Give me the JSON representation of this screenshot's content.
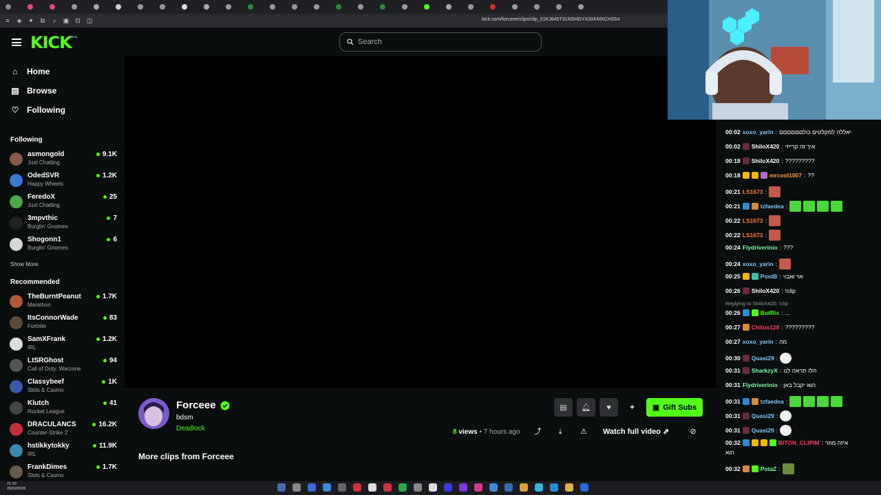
{
  "browser": {
    "url": "kick.com/forceee/clips/clip_01KJ845T31NSHGYX3XKMXCH3S4"
  },
  "header": {
    "logo": "KICK",
    "beta": "BETA",
    "search_placeholder": "Search"
  },
  "sidebar": {
    "nav": [
      {
        "label": "Home",
        "icon": "home-icon"
      },
      {
        "label": "Browse",
        "icon": "browse-icon"
      },
      {
        "label": "Following",
        "icon": "heart-icon"
      }
    ],
    "following_title": "Following",
    "following": [
      {
        "name": "asmongold",
        "category": "Just Chatting",
        "viewers": "9.1K",
        "color": "#8a5a4a"
      },
      {
        "name": "OdedSVR",
        "category": "Happy Wheels",
        "viewers": "1.2K",
        "color": "#3a7ad0"
      },
      {
        "name": "FeredoX",
        "category": "Just Chatting",
        "viewers": "25",
        "color": "#4aa84a"
      },
      {
        "name": "3mpvthic",
        "category": "Burglin' Gnomes",
        "viewers": "7",
        "color": "#222"
      },
      {
        "name": "Shogonn1",
        "category": "Burglin' Gnomes",
        "viewers": "6",
        "color": "#d8d8d8"
      }
    ],
    "show_more": "Show More",
    "recommended_title": "Recommended",
    "recommended": [
      {
        "name": "TheBurntPeanut",
        "category": "Marathon",
        "viewers": "1.7K",
        "color": "#b05a3a"
      },
      {
        "name": "ItsConnorWade",
        "category": "Fortnite",
        "viewers": "83",
        "color": "#5a4a3a"
      },
      {
        "name": "SamXFrank",
        "category": "IRL",
        "viewers": "1.2K",
        "color": "#ddd"
      },
      {
        "name": "LtSRGhost",
        "category": "Call of Duty: Warzone",
        "viewers": "94",
        "color": "#555"
      },
      {
        "name": "Classybeef",
        "category": "Slots & Casino",
        "viewers": "1K",
        "color": "#3a5aa8"
      },
      {
        "name": "Klutch",
        "category": "Rocket League",
        "viewers": "41",
        "color": "#444"
      },
      {
        "name": "DRACULANCS",
        "category": "Counter-Strike 2",
        "viewers": "16.2K",
        "color": "#c0303a"
      },
      {
        "name": "hstikkytokky",
        "category": "IRL",
        "viewers": "11.9K",
        "color": "#3a8ab0"
      },
      {
        "name": "FrankDimes",
        "category": "Slots & Casino",
        "viewers": "1.7K",
        "color": "#6a5a4a"
      }
    ]
  },
  "clip": {
    "channel": "Forceee",
    "title": "bdsm",
    "category": "Deadlock",
    "views_count": "8",
    "views_label": "views",
    "age": "• 7 hours ago",
    "gift_label": "Gift Subs",
    "watch_full": "Watch full video",
    "more_clips": "More clips from Forceee"
  },
  "chat": {
    "replying": "Replying to ShiloX420: !clip",
    "messages": [
      {
        "time": "00:02",
        "user": "xoxo_yarin",
        "color": "#7ec8ff",
        "text": "יאללה למקלטים כולםםםםםם",
        "badges": [],
        "emotes": 0
      },
      {
        "time": "00:02",
        "user": "ShiloX420",
        "color": "#ffffff",
        "text": "איך זה קרייזי",
        "badges": [
          "#6a2a3a"
        ],
        "emotes": 0
      },
      {
        "time": "00:18",
        "user": "ShiloX420",
        "color": "#ffffff",
        "text": "?????????",
        "badges": [
          "#6a2a3a"
        ],
        "emotes": 0
      },
      {
        "time": "00:18",
        "user": "mrcool1007",
        "color": "#ff9b3a",
        "text": "??",
        "badges": [
          "#f5b800",
          "#f5b800",
          "#b06ad8"
        ],
        "emotes": 0
      },
      {
        "time": "00:21",
        "user": "LS1673",
        "color": "#ff7a3a",
        "text": "",
        "badges": [],
        "emotes": 1
      },
      {
        "time": "00:21",
        "user": "tzfaedea",
        "color": "#7ec8ff",
        "text": "",
        "badges": [
          "#2a8ad8",
          "#d88a3a"
        ],
        "emotes": 4
      },
      {
        "time": "00:22",
        "user": "LS1673",
        "color": "#ff7a3a",
        "text": "",
        "badges": [],
        "emotes": 1
      },
      {
        "time": "00:22",
        "user": "LS1673",
        "color": "#ff7a3a",
        "text": "",
        "badges": [],
        "emotes": 1
      },
      {
        "time": "00:24",
        "user": "Flydriverinio",
        "color": "#7effa8",
        "text": "???",
        "badges": [],
        "emotes": 0
      },
      {
        "time": "00:24",
        "user": "xoxo_yarin",
        "color": "#7ec8ff",
        "text": "",
        "badges": [],
        "emotes": 1
      },
      {
        "time": "00:25",
        "user": "PostB",
        "color": "#7ec8ff",
        "text": "אוי ואבוי",
        "badges": [
          "#f5b800",
          "#3ac0a8"
        ],
        "emotes": 0
      },
      {
        "time": "00:26",
        "user": "ShiloX420",
        "color": "#ffffff",
        "text": "!clip",
        "badges": [
          "#6a2a3a"
        ],
        "emotes": 0
      },
      {
        "time": "00:26",
        "user": "BotRix",
        "color": "#53fc18",
        "text": "...",
        "badges": [
          "#2a8ad8",
          "#53fc18"
        ],
        "emotes": 0
      },
      {
        "time": "00:27",
        "user": "Chitos128",
        "color": "#ff3a5a",
        "text": "?????????",
        "badges": [
          "#d88a3a"
        ],
        "emotes": 0
      },
      {
        "time": "00:27",
        "user": "xoxo_yarin",
        "color": "#7ec8ff",
        "text": "מה",
        "badges": [],
        "emotes": 0
      },
      {
        "time": "00:30",
        "user": "Quasi29",
        "color": "#7ec8ff",
        "text": "",
        "badges": [
          "#6a2a3a"
        ],
        "emotes": 1
      },
      {
        "time": "00:31",
        "user": "SharkzyX",
        "color": "#7effa8",
        "text": "הלו תראה לנו",
        "badges": [
          "#6a2a3a"
        ],
        "emotes": 0
      },
      {
        "time": "00:31",
        "user": "Flydriverinio",
        "color": "#7effa8",
        "text": "הוא יקבל באן",
        "badges": [],
        "emotes": 0
      },
      {
        "time": "00:31",
        "user": "tzfaedea",
        "color": "#7ec8ff",
        "text": "",
        "badges": [
          "#2a8ad8",
          "#d88a3a"
        ],
        "emotes": 4
      },
      {
        "time": "00:31",
        "user": "Quasi29",
        "color": "#7ec8ff",
        "text": "",
        "badges": [
          "#6a2a3a"
        ],
        "emotes": 1
      },
      {
        "time": "00:31",
        "user": "Quasi29",
        "color": "#7ec8ff",
        "text": "",
        "badges": [
          "#6a2a3a"
        ],
        "emotes": 1
      },
      {
        "time": "00:32",
        "user": "BITON_CLIPIM",
        "color": "#ff3a5a",
        "text": "איזה מוזר",
        "badges": [
          "#2a8ad8",
          "#f5b800",
          "#f5b800",
          "#53fc18"
        ],
        "emotes": 0
      },
      {
        "time": "00:32",
        "user": "PotaZ",
        "color": "#7effa8",
        "text": "",
        "badges": [
          "#d88a3a",
          "#53fc18"
        ],
        "emotes": 1
      }
    ],
    "wrap_text": "הוא"
  },
  "taskbar": {
    "time": "21:30",
    "date": "28/02/2026"
  }
}
